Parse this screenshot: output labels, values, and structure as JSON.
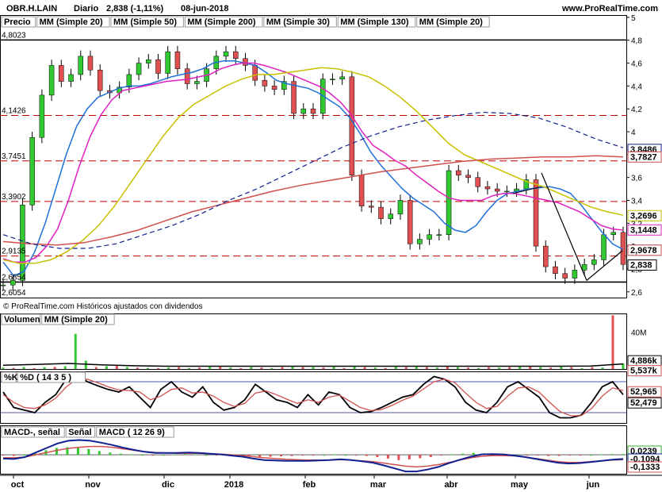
{
  "header": {
    "symbol": "OBR.H.LAIN",
    "period": "Diario",
    "quote": "2,838 (-1,11%)",
    "date": "08-jun-2018",
    "site": "www.ProRealTime.com"
  },
  "legend_price": [
    {
      "label": "Precio",
      "color": "#000000"
    },
    {
      "label": "MM (Simple 20)",
      "color": "#1e6fd6"
    },
    {
      "label": "MM (Simple 50)",
      "color": "#c8c000"
    },
    {
      "label": "MM (Simple 200)",
      "color": "#d05050"
    },
    {
      "label": "MM (Simple 30)",
      "color": "#e020c0"
    },
    {
      "label": "MM (Simple 130)",
      "color": "#102090"
    },
    {
      "label": "MM (Simple 20)",
      "color": "#d05050"
    }
  ],
  "footer_note": "© ProRealTime.com  Históricos ajustados con dividendos",
  "volume_legend": [
    {
      "label": "Volumen",
      "color": "#d05050"
    },
    {
      "label": "MM (Simple 20)",
      "color": "#000000"
    }
  ],
  "stoch_legend": [
    {
      "label": "%K",
      "color": "#000000"
    },
    {
      "label": "%D ( 14 3 5 )",
      "color": "#d05050"
    }
  ],
  "macd_legend": [
    {
      "label": "MACD-, señal",
      "color": "#30b030"
    },
    {
      "label": "Señal",
      "color": "#d05050"
    },
    {
      "label": "MACD ( 12 26 9)",
      "color": "#102090"
    }
  ],
  "months": [
    "oct",
    "nov",
    "dic",
    "2018",
    "feb",
    "mar",
    "abr",
    "may",
    "jun"
  ],
  "chart_data": [
    {
      "type": "line",
      "panel": "price",
      "yticks": [
        2.6,
        2.8,
        3.0,
        3.2,
        3.4,
        3.6,
        3.8,
        4.0,
        4.2,
        4.4,
        4.6,
        4.8,
        5.0
      ],
      "ytick_labels": [
        "2,6",
        "2,8",
        "3",
        "3,2",
        "3,4",
        "3,6",
        "3,8",
        "4",
        "4,2",
        "4,4",
        "4,6",
        "4,8",
        "5"
      ],
      "ylim": [
        2.55,
        5.02
      ],
      "horizontal_levels": [
        {
          "value": 4.8023,
          "label": "4,8023",
          "style": "solid"
        },
        {
          "value": 4.1426,
          "label": "4,1426",
          "style": "dashed"
        },
        {
          "value": 3.7451,
          "label": "3,7451",
          "style": "dashed"
        },
        {
          "value": 3.3902,
          "label": "3,3902",
          "style": "dashed"
        },
        {
          "value": 2.9135,
          "label": "2,9135",
          "style": "dashed"
        },
        {
          "value": 2.6854,
          "label": "2,6854",
          "style": "solid"
        }
      ],
      "extra_left_labels": [
        "2,6054"
      ],
      "value_tags": [
        {
          "label": "3,8486",
          "value": 3.8486,
          "color": "#102090"
        },
        {
          "label": "3,7827",
          "value": 3.7827,
          "color": "#d05050"
        },
        {
          "label": "3,2696",
          "value": 3.2696,
          "color": "#c8c000"
        },
        {
          "label": "3,1448",
          "value": 3.1448,
          "color": "#e020c0"
        },
        {
          "label": "2,9678",
          "value": 2.9678,
          "color": "#1e6fd6"
        },
        {
          "label": "2,9678",
          "value": 2.9678,
          "color": "#d05050"
        },
        {
          "label": "2,838",
          "value": 2.838,
          "color": "#000000"
        }
      ],
      "series": [
        {
          "name": "Precio",
          "values": [
            2.66,
            2.7,
            3.36,
            3.95,
            4.32,
            4.58,
            4.44,
            4.5,
            4.66,
            4.54,
            4.36,
            4.34,
            4.39,
            4.5,
            4.6,
            4.63,
            4.51,
            4.7,
            4.55,
            4.42,
            4.44,
            4.55,
            4.66,
            4.7,
            4.64,
            4.58,
            4.45,
            4.4,
            4.37,
            4.44,
            4.16,
            4.2,
            4.16,
            4.46,
            4.46,
            4.48,
            3.62,
            3.35,
            3.34,
            3.24,
            3.28,
            3.4,
            3.02,
            3.06,
            3.1,
            3.1,
            3.66,
            3.62,
            3.6,
            3.52,
            3.5,
            3.48,
            3.48,
            3.5,
            3.58,
            3.0,
            2.82,
            2.76,
            2.72,
            2.79,
            2.84,
            2.88,
            3.1,
            3.12,
            2.84
          ]
        },
        {
          "name": "MM (Simple 20)",
          "values": [
            2.86,
            2.74,
            2.78,
            2.95,
            3.2,
            3.5,
            3.8,
            4.05,
            4.2,
            4.3,
            4.34,
            4.38,
            4.4,
            4.4,
            4.42,
            4.45,
            4.48,
            4.5,
            4.52,
            4.55,
            4.6,
            4.62,
            4.62,
            4.6,
            4.58,
            4.52,
            4.45,
            4.42,
            4.4,
            4.38,
            4.34,
            4.28,
            4.22,
            4.12,
            3.98,
            3.82,
            3.7,
            3.6,
            3.5,
            3.42,
            3.36,
            3.3,
            3.2,
            3.14,
            3.12,
            3.18,
            3.3,
            3.4,
            3.46,
            3.48,
            3.5,
            3.51,
            3.52,
            3.5,
            3.46,
            3.36,
            3.24,
            3.12,
            3.02,
            2.97
          ]
        },
        {
          "name": "MM (Simple 30)",
          "values": [
            2.89,
            2.86,
            2.86,
            2.9,
            3.0,
            3.15,
            3.4,
            3.7,
            3.96,
            4.15,
            4.28,
            4.36,
            4.38,
            4.4,
            4.42,
            4.44,
            4.45,
            4.46,
            4.48,
            4.5,
            4.55,
            4.58,
            4.6,
            4.6,
            4.58,
            4.55,
            4.52,
            4.48,
            4.44,
            4.4,
            4.34,
            4.26,
            4.15,
            4.0,
            3.88,
            3.82,
            3.75,
            3.7,
            3.62,
            3.55,
            3.48,
            3.42,
            3.4,
            3.4,
            3.4,
            3.44,
            3.46,
            3.46,
            3.44,
            3.42,
            3.4,
            3.38,
            3.34,
            3.3,
            3.24,
            3.18,
            3.15,
            3.14
          ]
        },
        {
          "name": "MM (Simple 50)",
          "values": [
            2.88,
            2.85,
            2.85,
            2.88,
            2.95,
            3.05,
            3.18,
            3.35,
            3.55,
            3.75,
            3.95,
            4.12,
            4.24,
            4.32,
            4.4,
            4.46,
            4.5,
            4.5,
            4.52,
            4.54,
            4.56,
            4.55,
            4.52,
            4.48,
            4.4,
            4.3,
            4.18,
            4.04,
            3.9,
            3.8,
            3.74,
            3.68,
            3.62,
            3.56,
            3.52,
            3.46,
            3.4,
            3.34,
            3.3,
            3.27
          ]
        },
        {
          "name": "MM (Simple 200)",
          "values": [
            3.04,
            3.02,
            3.01,
            3.03,
            3.08,
            3.14,
            3.22,
            3.3,
            3.36,
            3.42,
            3.48,
            3.53,
            3.57,
            3.61,
            3.65,
            3.68,
            3.71,
            3.74,
            3.76,
            3.77,
            3.78,
            3.78,
            3.79,
            3.78
          ]
        },
        {
          "name": "MM (Simple 130)",
          "values": [
            3.1,
            3.02,
            2.98,
            2.98,
            3.02,
            3.1,
            3.18,
            3.28,
            3.4,
            3.5,
            3.62,
            3.74,
            3.86,
            3.96,
            4.04,
            4.1,
            4.14,
            4.17,
            4.16,
            4.12,
            4.04,
            3.94,
            3.86
          ]
        }
      ]
    },
    {
      "type": "bar",
      "panel": "volume",
      "yticks": [
        "40M",
        "4,886k",
        "5,537k"
      ],
      "series": [
        {
          "name": "Volumen",
          "values": [
            1.5,
            1.2,
            2.0,
            1.0,
            1.8,
            2.2,
            3.0,
            38.0,
            9.0,
            2.0,
            3.0,
            4.0,
            2.0,
            1.5,
            1.2,
            1.0,
            1.5,
            2.0,
            1.0,
            1.5,
            3.0,
            2.5,
            1.5,
            1.0,
            2.0,
            1.5,
            1.0,
            2.0,
            3.0,
            2.0,
            2.0,
            1.5,
            2.5,
            1.0,
            3.0,
            2.0,
            1.5,
            1.0,
            2.5,
            2.0,
            3.0,
            2.0,
            1.5,
            2.5,
            2.0,
            1.5,
            1.0,
            2.0,
            1.5,
            2.0,
            3.0,
            2.5,
            2.0,
            1.5,
            2.5,
            2.0,
            1.0,
            2.0,
            1.5,
            58.0,
            6.0
          ]
        },
        {
          "name": "MM (Simple 20)",
          "values": [
            4.0,
            5.0,
            6.0,
            4.5,
            3.5,
            3.0,
            3.0,
            3.0,
            3.0,
            3.0,
            3.0,
            3.0,
            3.0,
            3.0,
            3.0,
            3.0,
            3.0,
            3.0,
            3.2,
            5.5
          ]
        }
      ]
    },
    {
      "type": "line",
      "panel": "stochastic",
      "value_tags": [
        {
          "label": "52,965",
          "color": "#d05050"
        },
        {
          "label": "52,479",
          "color": "#000000"
        }
      ],
      "series": [
        {
          "name": "%K",
          "values": [
            60,
            30,
            25,
            20,
            40,
            55,
            85,
            95,
            80,
            72,
            65,
            60,
            70,
            50,
            30,
            65,
            80,
            60,
            50,
            70,
            40,
            25,
            30,
            45,
            75,
            60,
            45,
            40,
            30,
            55,
            35,
            60,
            55,
            30,
            20,
            22,
            30,
            40,
            50,
            55,
            75,
            90,
            85,
            70,
            40,
            25,
            20,
            40,
            70,
            80,
            65,
            50,
            20,
            10,
            10,
            15,
            40,
            70,
            80,
            55
          ]
        },
        {
          "name": "%D ( 14 3 5 )",
          "values": [
            55,
            40,
            30,
            28,
            35,
            48,
            70,
            85,
            85,
            78,
            70,
            64,
            63,
            60,
            45,
            52,
            65,
            68,
            58,
            60,
            52,
            40,
            32,
            38,
            58,
            62,
            55,
            46,
            38,
            45,
            40,
            50,
            54,
            42,
            30,
            24,
            26,
            34,
            44,
            52,
            66,
            80,
            85,
            78,
            58,
            40,
            28,
            32,
            52,
            68,
            70,
            60,
            40,
            22,
            14,
            14,
            28,
            52,
            68,
            63
          ]
        }
      ]
    },
    {
      "type": "bar",
      "panel": "macd",
      "value_tags": [
        {
          "label": "0,0239",
          "color": "#30b030"
        },
        {
          "label": "-0,1094",
          "color": "#102090"
        },
        {
          "label": "-0,1333",
          "color": "#d05050"
        }
      ],
      "series": [
        {
          "name": "MACD-, señal",
          "values": [
            -0.02,
            -0.03,
            0.0,
            0.06,
            0.12,
            0.18,
            0.2,
            0.19,
            0.15,
            0.1,
            0.06,
            0.03,
            0.01,
            0.0,
            -0.01,
            0.0,
            0.01,
            0.02,
            0.01,
            0.0,
            -0.01,
            -0.02,
            -0.03,
            -0.05,
            -0.06,
            -0.05,
            -0.04,
            -0.03,
            -0.02,
            -0.01,
            0.0,
            0.01,
            0.0,
            -0.01,
            -0.03,
            -0.06,
            -0.1,
            -0.14,
            -0.12,
            -0.09,
            -0.06,
            -0.02,
            0.01,
            0.03,
            0.05,
            0.04,
            0.03,
            0.01,
            0.0,
            -0.01,
            -0.02,
            -0.03,
            -0.03,
            -0.02,
            -0.01,
            0.0,
            0.01,
            0.02,
            0.02
          ]
        },
        {
          "name": "Señal",
          "values": [
            -0.08,
            -0.08,
            -0.06,
            0.0,
            0.06,
            0.12,
            0.17,
            0.2,
            0.22,
            0.22,
            0.2,
            0.16,
            0.12,
            0.08,
            0.06,
            0.05,
            0.04,
            0.04,
            0.04,
            0.03,
            0.02,
            0.0,
            -0.02,
            -0.05,
            -0.08,
            -0.1,
            -0.12,
            -0.13,
            -0.14,
            -0.14,
            -0.14,
            -0.13,
            -0.14,
            -0.16,
            -0.18,
            -0.22,
            -0.26,
            -0.3,
            -0.32,
            -0.3,
            -0.26,
            -0.2,
            -0.14,
            -0.08,
            -0.04,
            -0.02,
            -0.02,
            -0.03,
            -0.06,
            -0.1,
            -0.14,
            -0.18,
            -0.2,
            -0.2,
            -0.18,
            -0.16,
            -0.14,
            -0.13
          ]
        },
        {
          "name": "MACD ( 12 26 9)",
          "values": [
            -0.1,
            -0.11,
            -0.06,
            0.06,
            0.18,
            0.3,
            0.37,
            0.39,
            0.37,
            0.32,
            0.26,
            0.19,
            0.13,
            0.08,
            0.05,
            0.05,
            0.05,
            0.06,
            0.05,
            0.03,
            0.01,
            -0.02,
            -0.05,
            -0.1,
            -0.14,
            -0.15,
            -0.16,
            -0.16,
            -0.16,
            -0.15,
            -0.14,
            -0.12,
            -0.14,
            -0.17,
            -0.21,
            -0.28,
            -0.36,
            -0.44,
            -0.44,
            -0.39,
            -0.32,
            -0.22,
            -0.13,
            -0.05,
            0.01,
            0.02,
            0.01,
            -0.02,
            -0.06,
            -0.11,
            -0.16,
            -0.21,
            -0.23,
            -0.22,
            -0.19,
            -0.16,
            -0.13,
            -0.11
          ]
        }
      ]
    }
  ]
}
